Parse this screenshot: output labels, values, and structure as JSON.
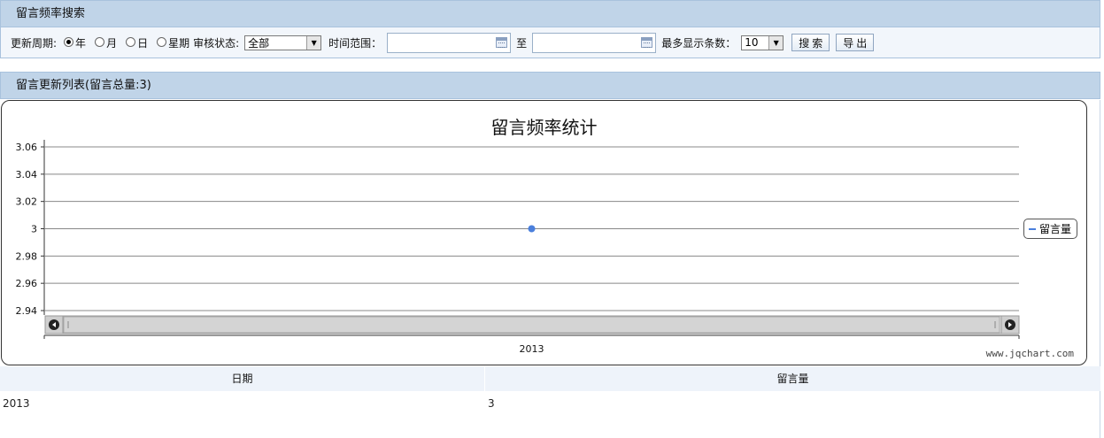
{
  "search_panel": {
    "title": "留言频率搜索"
  },
  "search": {
    "period_label": "更新周期:",
    "period_options": [
      {
        "label": "年",
        "selected": true
      },
      {
        "label": "月",
        "selected": false
      },
      {
        "label": "日",
        "selected": false
      },
      {
        "label": "星期",
        "selected": false
      }
    ],
    "status_label": "审核状态:",
    "status_value": "全部",
    "time_range_label": "时间范围：",
    "time_from": "",
    "to_label": "至",
    "time_to": "",
    "max_label": "最多显示条数：",
    "max_value": "10",
    "search_button": "搜索",
    "export_button": "导出"
  },
  "list_panel": {
    "title": "留言更新列表(留言总量:3)"
  },
  "chart_data": {
    "type": "line",
    "title": "留言频率统计",
    "categories": [
      "2013"
    ],
    "series": [
      {
        "name": "留言量",
        "values": [
          3
        ],
        "color": "#4a7fdc"
      }
    ],
    "y_ticks": [
      "3.06",
      "3.04",
      "3.02",
      "3",
      "2.98",
      "2.96",
      "2.94"
    ],
    "ylim": [
      2.94,
      3.06
    ],
    "grid": true,
    "legend_position": "right",
    "credit": "www.jqchart.com"
  },
  "table": {
    "columns": [
      "日期",
      "留言量"
    ],
    "rows": [
      [
        "2013",
        "3"
      ]
    ]
  }
}
